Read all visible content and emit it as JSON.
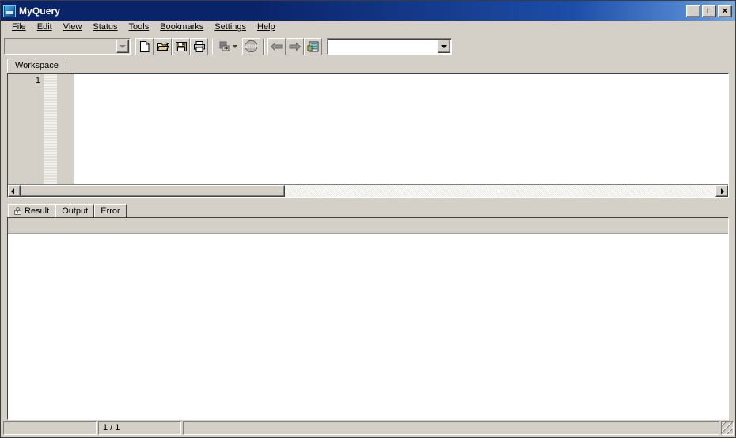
{
  "window": {
    "title": "MyQuery",
    "app_icon": "myquery-app-icon",
    "controls": {
      "minimize": "_",
      "maximize": "□",
      "close": "✕"
    }
  },
  "menubar": {
    "items": [
      {
        "label": "File",
        "accel": "F"
      },
      {
        "label": "Edit",
        "accel": "E"
      },
      {
        "label": "View",
        "accel": "V"
      },
      {
        "label": "Status",
        "accel": "S"
      },
      {
        "label": "Tools",
        "accel": "T"
      },
      {
        "label": "Bookmarks",
        "accel": "B"
      },
      {
        "label": "Settings",
        "accel": "g"
      },
      {
        "label": "Help",
        "accel": "H"
      }
    ]
  },
  "toolbar": {
    "connection_combo": {
      "name": "connection-combo",
      "value": "",
      "placeholder": "",
      "enabled": false
    },
    "buttons": [
      {
        "name": "new-file-button",
        "icon": "new-document-icon",
        "label": "New"
      },
      {
        "name": "open-file-button",
        "icon": "open-folder-icon",
        "label": "Open"
      },
      {
        "name": "save-file-button",
        "icon": "floppy-disk-icon",
        "label": "Save"
      },
      {
        "name": "print-button",
        "icon": "printer-icon",
        "label": "Print"
      },
      {
        "name": "execute-button",
        "icon": "execute-query-icon",
        "label": "Execute",
        "has_dropdown": true
      },
      {
        "name": "stop-button",
        "icon": "stop-sign-icon",
        "label": "Stop"
      },
      {
        "name": "back-button",
        "icon": "arrow-left-icon",
        "label": "Back"
      },
      {
        "name": "forward-button",
        "icon": "arrow-right-icon",
        "label": "Forward"
      },
      {
        "name": "database-button",
        "icon": "database-icon",
        "label": "Database"
      }
    ],
    "query-combo": {
      "name": "query-history-combo",
      "value": "",
      "placeholder": "",
      "enabled": true
    }
  },
  "workspace": {
    "tabs": [
      {
        "label": "Workspace",
        "active": true
      }
    ],
    "editor": {
      "line_numbers": [
        "1"
      ],
      "content": "",
      "hscroll": {
        "thumb_percent": 38,
        "left_arrow": "scroll-left-arrow",
        "right_arrow": "scroll-right-arrow"
      }
    }
  },
  "results": {
    "tabs": [
      {
        "label": "Result",
        "active": true,
        "icon": "lock-icon"
      },
      {
        "label": "Output",
        "active": false,
        "icon": ""
      },
      {
        "label": "Error",
        "active": false,
        "icon": ""
      }
    ],
    "grid": {
      "columns": [],
      "rows": []
    }
  },
  "statusbar": {
    "panel1": "",
    "panel2": "1 / 1",
    "panel3": "",
    "grip": "resize-grip"
  },
  "colors": {
    "face": "#d4d0c8",
    "title_start": "#0a246a",
    "title_end": "#7ea9e0",
    "window_bg": "#ffffff",
    "shadow": "#808080",
    "dark": "#404040",
    "light": "#ffffff"
  }
}
